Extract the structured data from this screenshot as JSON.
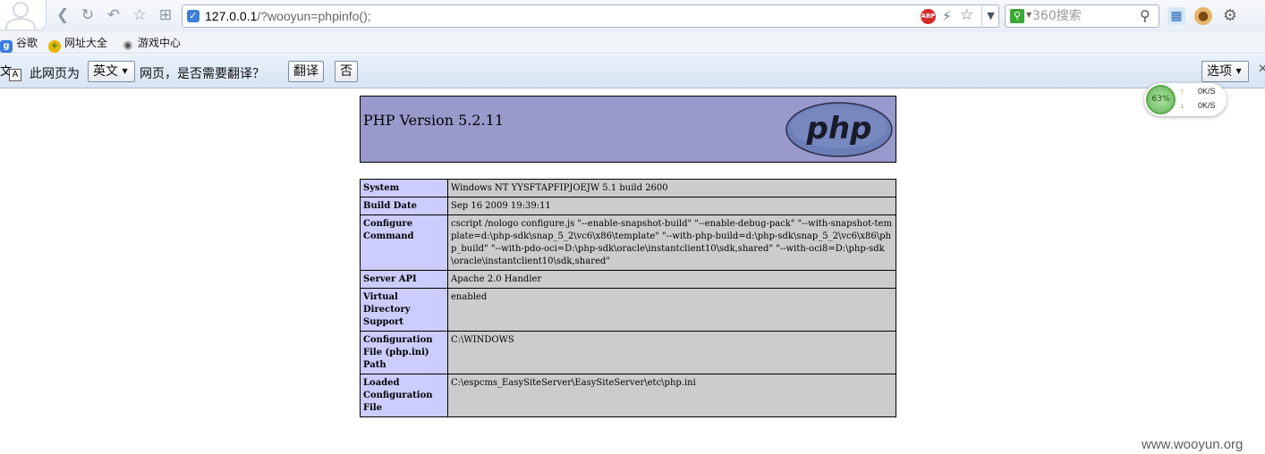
{
  "browser": {
    "url_host": "127.0.0.1",
    "url_path": "/?wooyun=phpinfo();",
    "search_placeholder": "360搜索"
  },
  "bookmarks": [
    {
      "label": "谷歌",
      "icon": "google-icon"
    },
    {
      "label": "网址大全",
      "icon": "wangzhi-icon"
    },
    {
      "label": "游戏中心",
      "icon": "gamepad-icon"
    }
  ],
  "translate_bar": {
    "prefix": "此网页为",
    "language": "英文",
    "suffix": "网页，是否需要翻译？",
    "translate_button": "翻译",
    "no_button": "否",
    "options_button": "选项"
  },
  "speed_widget": {
    "memory": "63%",
    "upload": "0K/S",
    "download": "0K/S"
  },
  "php": {
    "title": "PHP Version 5.2.11",
    "logo_text": "php",
    "rows": [
      {
        "label": "System",
        "value": "Windows NT YYSFTAPFIPJOEJW 5.1 build 2600"
      },
      {
        "label": "Build Date",
        "value": "Sep 16 2009 19:39:11"
      },
      {
        "label": "Configure Command",
        "value": "cscript /nologo configure.js \"--enable-snapshot-build\" \"--enable-debug-pack\" \"--with-snapshot-template=d:\\php-sdk\\snap_5_2\\vc6\\x86\\template\" \"--with-php-build=d:\\php-sdk\\snap_5_2\\vc6\\x86\\php_build\" \"--with-pdo-oci=D:\\php-sdk\\oracle\\instantclient10\\sdk,shared\" \"--with-oci8=D:\\php-sdk\\oracle\\instantclient10\\sdk,shared\""
      },
      {
        "label": "Server API",
        "value": "Apache 2.0 Handler"
      },
      {
        "label": "Virtual Directory Support",
        "value": "enabled"
      },
      {
        "label": "Configuration File (php.ini) Path",
        "value": "C:\\WINDOWS"
      },
      {
        "label": "Loaded Configuration File",
        "value": "C:\\espcms_EasySiteServer\\EasySiteServer\\etc\\php.ini"
      }
    ]
  },
  "watermark": "www.wooyun.org",
  "colors": {
    "php_header_bg": "#9999cc",
    "label_cell_bg": "#ccccff",
    "value_cell_bg": "#cccccc"
  }
}
